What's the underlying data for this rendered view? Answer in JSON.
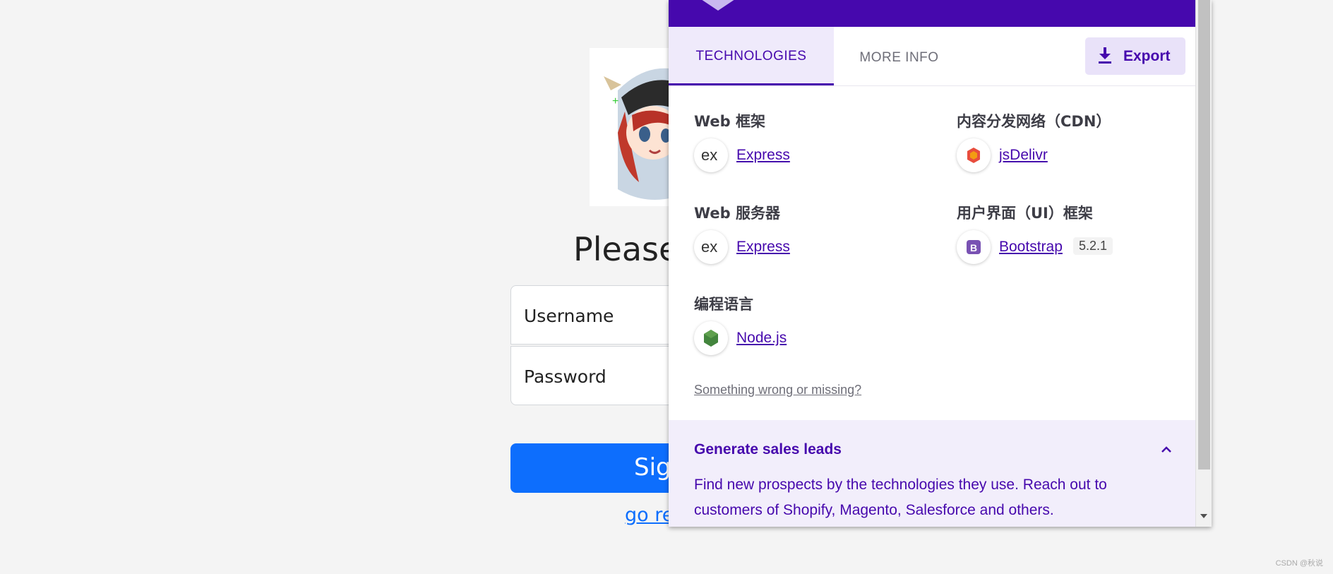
{
  "login": {
    "title": "Please",
    "username_placeholder": "Username",
    "password_placeholder": "Password",
    "signin_label": "Sign",
    "register_link": "go re"
  },
  "watermark": "CSDN @秋说",
  "popup": {
    "tabs": [
      {
        "label": "TECHNOLOGIES",
        "active": true
      },
      {
        "label": "MORE INFO",
        "active": false
      }
    ],
    "export_label": "Export",
    "categories": [
      {
        "title": "Web 框架",
        "techs": [
          {
            "name": "Express",
            "icon": "express-icon"
          }
        ]
      },
      {
        "title": "内容分发网络（CDN）",
        "techs": [
          {
            "name": "jsDelivr",
            "icon": "jsdelivr-icon"
          }
        ]
      },
      {
        "title": "Web 服务器",
        "techs": [
          {
            "name": "Express",
            "icon": "express-icon"
          }
        ]
      },
      {
        "title": "用户界面（UI）框架",
        "techs": [
          {
            "name": "Bootstrap",
            "icon": "bootstrap-icon",
            "version": "5.2.1"
          }
        ]
      },
      {
        "title": "编程语言",
        "techs": [
          {
            "name": "Node.js",
            "icon": "nodejs-icon"
          }
        ]
      }
    ],
    "wrong_link": "Something wrong or missing?",
    "leads": {
      "title": "Generate sales leads",
      "text": "Find new prospects by the technologies they use. Reach out to customers of Shopify, Magento, Salesforce and others."
    }
  },
  "colors": {
    "brand": "#4608ad",
    "primary_button": "#0d6efd"
  }
}
